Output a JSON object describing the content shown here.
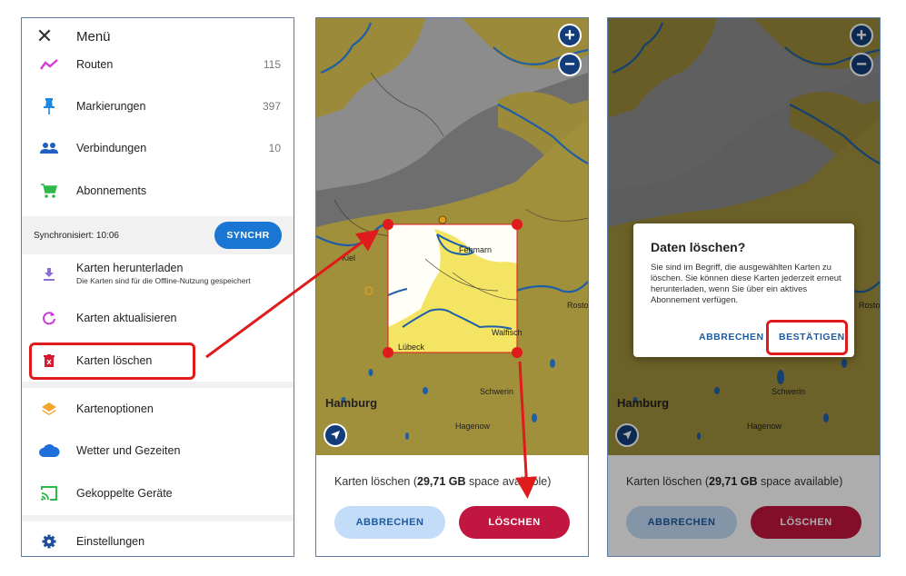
{
  "menu": {
    "title": "Menü",
    "items": [
      {
        "label": "Routen",
        "count": "115",
        "icon": "route-icon",
        "color": "#d63bd6"
      },
      {
        "label": "Markierungen",
        "count": "397",
        "icon": "pin-icon",
        "color": "#1e88e5"
      },
      {
        "label": "Verbindungen",
        "count": "10",
        "icon": "people-icon",
        "color": "#1e5fbf"
      },
      {
        "label": "Abonnements",
        "count": "",
        "icon": "cart-icon",
        "color": "#2eb84a"
      }
    ],
    "sync": {
      "text": "Synchronisiert: 10:06",
      "button": "SYNCHR"
    },
    "download": {
      "label": "Karten herunterladen",
      "sub": "Die Karten sind für die Offline-Nutzung gespeichert",
      "icon": "download-icon"
    },
    "refresh": {
      "label": "Karten aktualisieren",
      "icon": "refresh-icon"
    },
    "delete": {
      "label": "Karten löschen",
      "icon": "trash-icon"
    },
    "options": {
      "label": "Kartenoptionen",
      "icon": "layers-icon"
    },
    "weather": {
      "label": "Wetter und Gezeiten",
      "icon": "cloud-icon"
    },
    "devices": {
      "label": "Gekoppelte Geräte",
      "icon": "cast-icon"
    },
    "settings": {
      "label": "Einstellungen",
      "icon": "gear-icon"
    }
  },
  "map": {
    "labels": {
      "fehmarn": "Fehmarn",
      "kiel": "Kiel",
      "walfisch": "Walfisch",
      "luebeck": "Lübeck",
      "rostock": "Rosto",
      "hamburg": "Hamburg",
      "schwerin": "Schwerin",
      "hagenow": "Hagenow"
    },
    "zoom_in": "+",
    "zoom_out": "−"
  },
  "sheet": {
    "text_prefix": "Karten löschen (",
    "size": "29,71 GB",
    "text_suffix": " space available)",
    "cancel": "ABBRECHEN",
    "delete": "LÖSCHEN"
  },
  "dialog": {
    "title": "Daten löschen?",
    "body": "Sie sind im Begriff, die ausgewählten Karten zu löschen. Sie können diese Karten jederzeit erneut herunterladen, wenn Sie über ein aktives Abonnement verfügen.",
    "cancel": "ABBRECHEN",
    "confirm": "BESTÄTIGEN"
  },
  "colors": {
    "highlight": "#e01b1b",
    "primary": "#1976d2",
    "danger": "#c0163f"
  }
}
